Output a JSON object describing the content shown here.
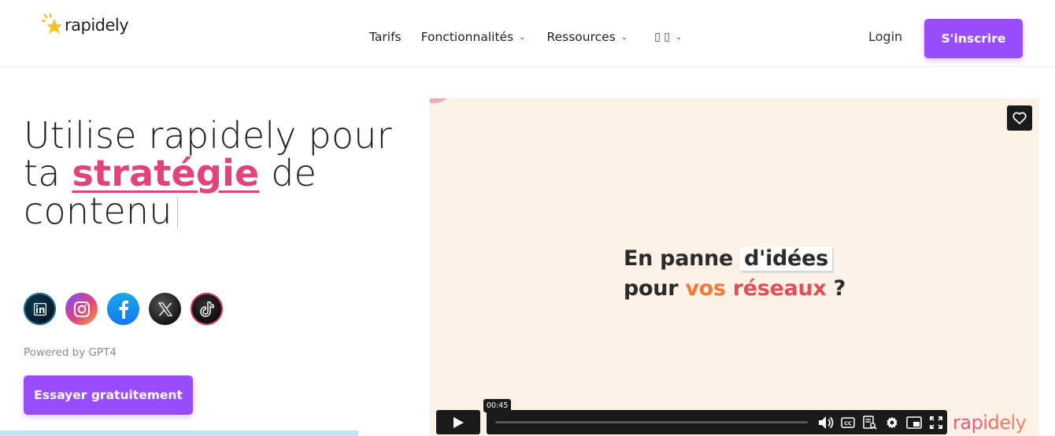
{
  "header": {
    "logo_text": "rapidely",
    "nav": [
      {
        "label": "Tarifs",
        "has_dropdown": false
      },
      {
        "label": "Fonctionnalités",
        "has_dropdown": true
      },
      {
        "label": "Ressources",
        "has_dropdown": true
      }
    ],
    "language_glyph": "▯ ▯",
    "login_label": "Login",
    "signup_label": "S'inscrire"
  },
  "hero": {
    "title_part1": "Utilise rapidely pour",
    "title_part2": "ta",
    "title_highlight": "stratégie",
    "title_part3": "de",
    "title_part4": "contenu",
    "socials": [
      "linkedin-icon",
      "instagram-icon",
      "facebook-icon",
      "x-icon",
      "tiktok-icon"
    ],
    "powered_by": "Powered by GPT4",
    "cta_label": "Essayer gratuitement"
  },
  "video": {
    "line1_a": "En panne",
    "line1_b": "d'idées",
    "line2_a": "pour",
    "line2_b": "vos",
    "line2_c": "réseaux",
    "line2_d": "?",
    "time_tooltip": "00:45",
    "logo_text": "rapidely"
  },
  "colors": {
    "accent": "#9a4dff",
    "highlight": "#e0447b",
    "video_bg": "#fbf1e4"
  }
}
